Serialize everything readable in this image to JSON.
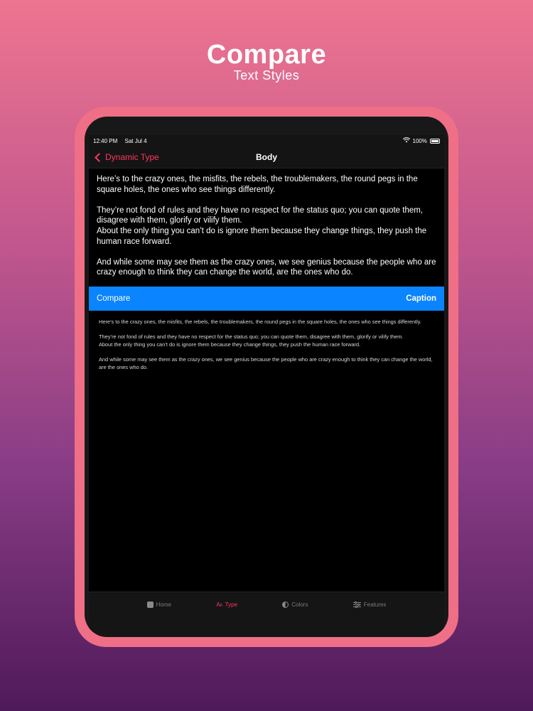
{
  "promo": {
    "title": "Compare",
    "subtitle": "Text Styles"
  },
  "status_bar": {
    "time": "12:40 PM",
    "date": "Sat Jul 4",
    "battery": "100%"
  },
  "nav": {
    "back_label": "Dynamic Type",
    "title": "Body"
  },
  "body": {
    "p1": "Here’s to the crazy ones, the misfits, the rebels, the troublemakers, the round pegs in the square holes, the ones who see things differently.",
    "p2": "They’re not fond of rules and they have no respect for the status quo; you can quote them, disagree with them, glorify or vilify them.",
    "p3": "About the only thing you can’t do is ignore them because they change things, they push the human race forward.",
    "p4": "And while some may see them as the crazy ones, we see genius because the people who are crazy enough to think they can change the world, are the ones who do."
  },
  "compare_bar": {
    "left_label": "Compare",
    "right_label": "Caption"
  },
  "caption": {
    "p1": "Here’s to the crazy ones, the misfits, the rebels, the troublemakers, the round pegs in the square holes, the ones who see things differently.",
    "p2": "They’re not fond of rules and they have no respect for the status quo; you can quote them, disagree with them, glorify or vilify them.",
    "p3": "About the only thing you can’t do is ignore them because they change things, they push the human race forward.",
    "p4": "And while some may see them as the crazy ones, we see genius because the people who are crazy enough to think they can change the world, are the ones who do."
  },
  "tabs": [
    {
      "label": "Home",
      "icon": "home-square-icon"
    },
    {
      "label": "Type",
      "icon": "text-size-icon",
      "active": true
    },
    {
      "label": "Colors",
      "icon": "contrast-icon"
    },
    {
      "label": "Features",
      "icon": "sliders-icon"
    }
  ],
  "colors": {
    "accent": "#ff375f",
    "compare_bar": "#0a84ff",
    "device_frame": "#ef6f86",
    "screen_bg": "#000000"
  }
}
